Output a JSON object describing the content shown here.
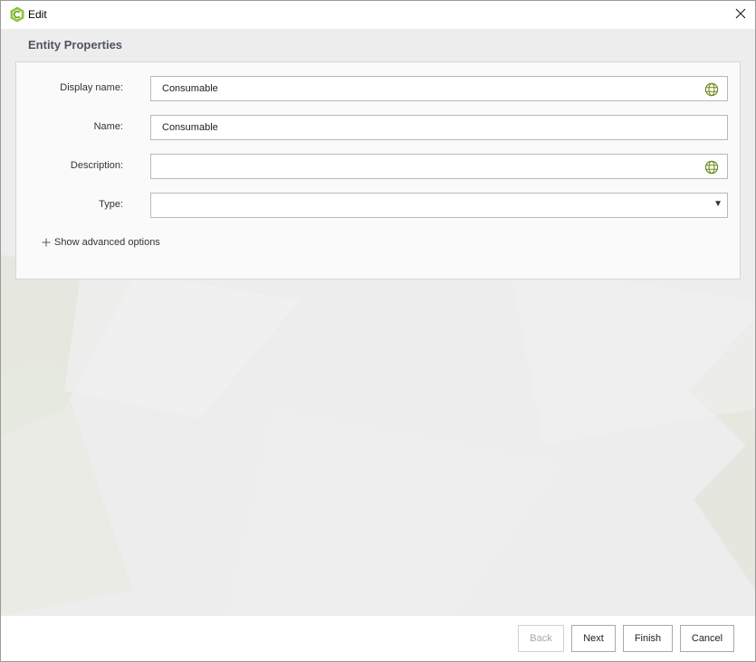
{
  "window": {
    "title": "Edit"
  },
  "section": {
    "title": "Entity Properties"
  },
  "form": {
    "display_name": {
      "label": "Display name:",
      "value": "Consumable"
    },
    "name": {
      "label": "Name:",
      "value": "Consumable"
    },
    "description": {
      "label": "Description:",
      "value": ""
    },
    "type": {
      "label": "Type:",
      "value": ""
    },
    "advanced_options": "Show advanced options"
  },
  "footer": {
    "back": "Back",
    "next": "Next",
    "finish": "Finish",
    "cancel": "Cancel"
  },
  "icons": {
    "app": "app-logo-icon",
    "close": "close-icon",
    "globe": "globe-icon",
    "dropdown": "chevron-down-icon",
    "plus": "plus-icon"
  },
  "colors": {
    "accent": "#8cc63f",
    "globe": "#6a8a1f",
    "section_title": "#4f5561"
  }
}
